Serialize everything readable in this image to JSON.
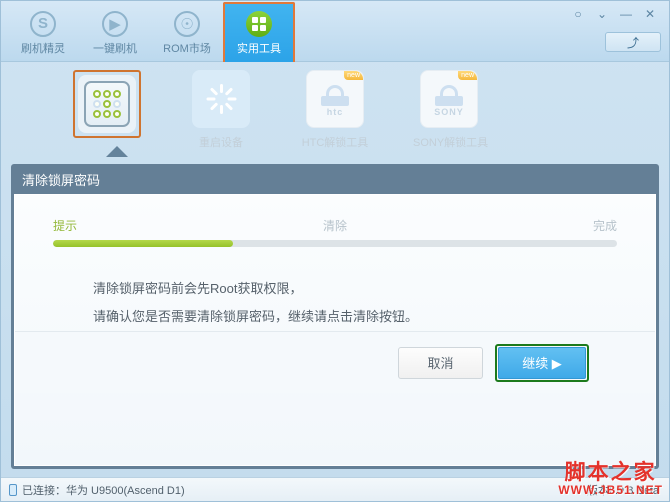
{
  "window": {
    "controls": [
      {
        "name": "feedback-icon",
        "glyph": "○"
      },
      {
        "name": "menu-icon",
        "glyph": "⌄"
      },
      {
        "name": "minimize-icon",
        "glyph": "—"
      },
      {
        "name": "close-icon",
        "glyph": "✕"
      }
    ],
    "download_button": "⤴"
  },
  "tabs": [
    {
      "label": "刷机精灵",
      "icon": "s-circle-icon",
      "active": false
    },
    {
      "label": "一键刷机",
      "icon": "play-circle-icon",
      "active": false
    },
    {
      "label": "ROM市场",
      "icon": "rom-circle-icon",
      "active": false
    },
    {
      "label": "实用工具",
      "icon": "grid-circle-icon",
      "active": true
    }
  ],
  "tools": [
    {
      "label": "",
      "icon": "pattern-lock-icon",
      "selected": true,
      "badge": ""
    },
    {
      "label": "重启设备",
      "icon": "spinner-icon",
      "selected": false,
      "badge": ""
    },
    {
      "label": "HTC解锁工具",
      "icon": "htc-lock-icon",
      "selected": false,
      "badge": "new",
      "brand": "htc"
    },
    {
      "label": "SONY解锁工具",
      "icon": "sony-lock-icon",
      "selected": false,
      "badge": "new",
      "brand": "SONY"
    }
  ],
  "panel": {
    "title": "清除锁屏密码",
    "steps": [
      {
        "label": "提示",
        "active": true
      },
      {
        "label": "清除",
        "active": false
      },
      {
        "label": "完成",
        "active": false
      }
    ],
    "progress_percent": 32,
    "messages": [
      "清除锁屏密码前会先Root获取权限，",
      "请确认您是否需要清除锁屏密码，继续请点击清除按钮。"
    ],
    "cancel_label": "取消",
    "next_label": "继续 ▶"
  },
  "status": {
    "connection": "已连接：华为 U9500(Ascend D1)",
    "version": "版本0.9.8 Beta"
  },
  "watermark": {
    "line1": "脚本之家",
    "line2": "WWW.JB51.NET"
  },
  "colors": {
    "accent_blue": "#3fa9e8",
    "accent_green": "#96c22b",
    "highlight_orange": "#cf7430",
    "highlight_green": "#1c7a1c",
    "panel_slate": "#647f96"
  }
}
